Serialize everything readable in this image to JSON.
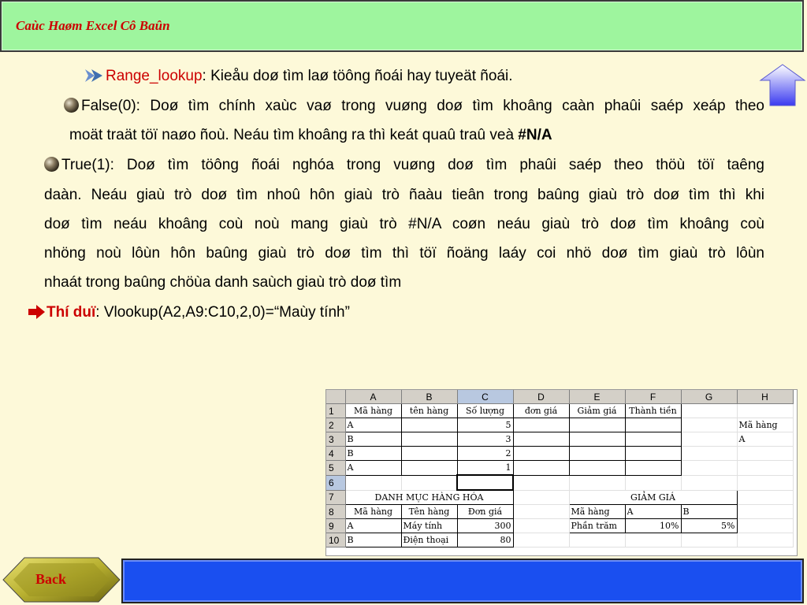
{
  "title": "Caùc Haøm Excel Cô Baûn",
  "content": {
    "range_lookup_label": "Range_lookup",
    "range_lookup_text": ": Kieåu doø tìm laø töông ñoái hay tuyeät ñoái.",
    "false_line1": "False(0): Doø tìm chính xaùc vaø trong vuøng doø tìm khoâng caàn phaûi saép xeáp theo",
    "false_line2": "moät traät töï naøo ñoù. Neáu tìm khoâng ra thì keát quaû traû veà ",
    "false_na": "#N/A",
    "true_line1": "True(1): Doø tìm töông ñoái nghóa trong vuøng doø tìm phaûi saép theo thöù töï taêng",
    "true_line2": "daàn. Neáu giaù trò doø tìm nhoû hôn giaù trò ñaàu tieân trong baûng giaù trò doø tìm thì khi",
    "true_line3": "doø tìm neáu khoâng coù noù mang giaù trò #N/A coøn neáu giaù trò doø tìm khoâng coù",
    "true_line4": "nhöng noù lôùn hôn baûng giaù trò doø tìm thì töï ñoäng laáy coi nhö doø tìm giaù trò lôùn",
    "true_line5": "nhaát trong baûng chöùa danh saùch giaù trò doø tìm",
    "example_label": "Thí duï",
    "example_text": ": Vlookup(A2,A9:C10,2,0)=“Maùy tính”"
  },
  "sheet": {
    "col_headers": [
      "A",
      "B",
      "C",
      "D",
      "E",
      "F",
      "G",
      "H"
    ],
    "row_headers": [
      "1",
      "2",
      "3",
      "4",
      "5",
      "6",
      "7",
      "8",
      "9",
      "10"
    ],
    "row1": [
      "Mã hàng",
      "tên hàng",
      "Số lượng",
      "đơn giá",
      "Giảm giá",
      "Thành tiền",
      "",
      ""
    ],
    "row2": [
      "A",
      "",
      "5",
      "",
      "",
      "",
      "",
      "Mã hàng"
    ],
    "row3": [
      "B",
      "",
      "3",
      "",
      "",
      "",
      "",
      "A"
    ],
    "row4": [
      "B",
      "",
      "2",
      "",
      "",
      "",
      "",
      ""
    ],
    "row5": [
      "A",
      "",
      "1",
      "",
      "",
      "",
      "",
      ""
    ],
    "row7_left": "DANH MỤC HÀNG HÓA",
    "row7_right": "GIẢM GIÁ",
    "row8": [
      "Mã hàng",
      "Tên hàng",
      "Đơn giá",
      "",
      "Mã hàng",
      "A",
      "B",
      ""
    ],
    "row9": [
      "A",
      "Máy tính",
      "300",
      "",
      "Phần trăm",
      "10%",
      "5%",
      ""
    ],
    "row10": [
      "B",
      "Điện thoại",
      "80",
      "",
      "",
      "",
      "",
      ""
    ]
  },
  "nav": {
    "back_label": "Back",
    "up_icon": "up-arrow-icon"
  },
  "colors": {
    "title_bar": "#9ef59e",
    "accent_red": "#cc0000",
    "bottom_bar": "#1a4ff0",
    "background": "#fdf9d9"
  }
}
